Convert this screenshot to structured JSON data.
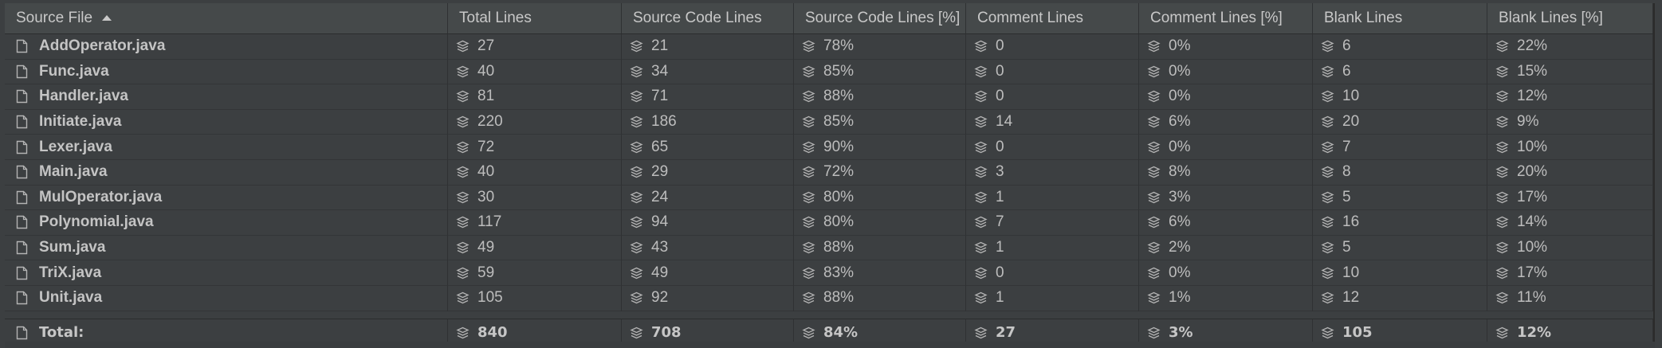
{
  "columns": [
    "Source File",
    "Total Lines",
    "Source Code Lines",
    "Source Code Lines [%]",
    "Comment Lines",
    "Comment Lines [%]",
    "Blank Lines",
    "Blank Lines [%]"
  ],
  "sort": {
    "column": "Source File",
    "direction": "ascending"
  },
  "rows": [
    {
      "file": "AddOperator.java",
      "total": "27",
      "source": "21",
      "source_pct": "78%",
      "comment": "0",
      "comment_pct": "0%",
      "blank": "6",
      "blank_pct": "22%"
    },
    {
      "file": "Func.java",
      "total": "40",
      "source": "34",
      "source_pct": "85%",
      "comment": "0",
      "comment_pct": "0%",
      "blank": "6",
      "blank_pct": "15%"
    },
    {
      "file": "Handler.java",
      "total": "81",
      "source": "71",
      "source_pct": "88%",
      "comment": "0",
      "comment_pct": "0%",
      "blank": "10",
      "blank_pct": "12%"
    },
    {
      "file": "Initiate.java",
      "total": "220",
      "source": "186",
      "source_pct": "85%",
      "comment": "14",
      "comment_pct": "6%",
      "blank": "20",
      "blank_pct": "9%"
    },
    {
      "file": "Lexer.java",
      "total": "72",
      "source": "65",
      "source_pct": "90%",
      "comment": "0",
      "comment_pct": "0%",
      "blank": "7",
      "blank_pct": "10%"
    },
    {
      "file": "Main.java",
      "total": "40",
      "source": "29",
      "source_pct": "72%",
      "comment": "3",
      "comment_pct": "8%",
      "blank": "8",
      "blank_pct": "20%"
    },
    {
      "file": "MulOperator.java",
      "total": "30",
      "source": "24",
      "source_pct": "80%",
      "comment": "1",
      "comment_pct": "3%",
      "blank": "5",
      "blank_pct": "17%"
    },
    {
      "file": "Polynomial.java",
      "total": "117",
      "source": "94",
      "source_pct": "80%",
      "comment": "7",
      "comment_pct": "6%",
      "blank": "16",
      "blank_pct": "14%"
    },
    {
      "file": "Sum.java",
      "total": "49",
      "source": "43",
      "source_pct": "88%",
      "comment": "1",
      "comment_pct": "2%",
      "blank": "5",
      "blank_pct": "10%"
    },
    {
      "file": "TriX.java",
      "total": "59",
      "source": "49",
      "source_pct": "83%",
      "comment": "0",
      "comment_pct": "0%",
      "blank": "10",
      "blank_pct": "17%"
    },
    {
      "file": "Unit.java",
      "total": "105",
      "source": "92",
      "source_pct": "88%",
      "comment": "1",
      "comment_pct": "1%",
      "blank": "12",
      "blank_pct": "11%"
    }
  ],
  "total": {
    "label": "Total:",
    "total": "840",
    "source": "708",
    "source_pct": "84%",
    "comment": "27",
    "comment_pct": "3%",
    "blank": "105",
    "blank_pct": "12%"
  },
  "icons": {
    "file": "file-icon",
    "metric": "stack-icon"
  },
  "colors": {
    "background": "#3c3f41",
    "header": "#45494a",
    "text": "#bbbbbb"
  }
}
